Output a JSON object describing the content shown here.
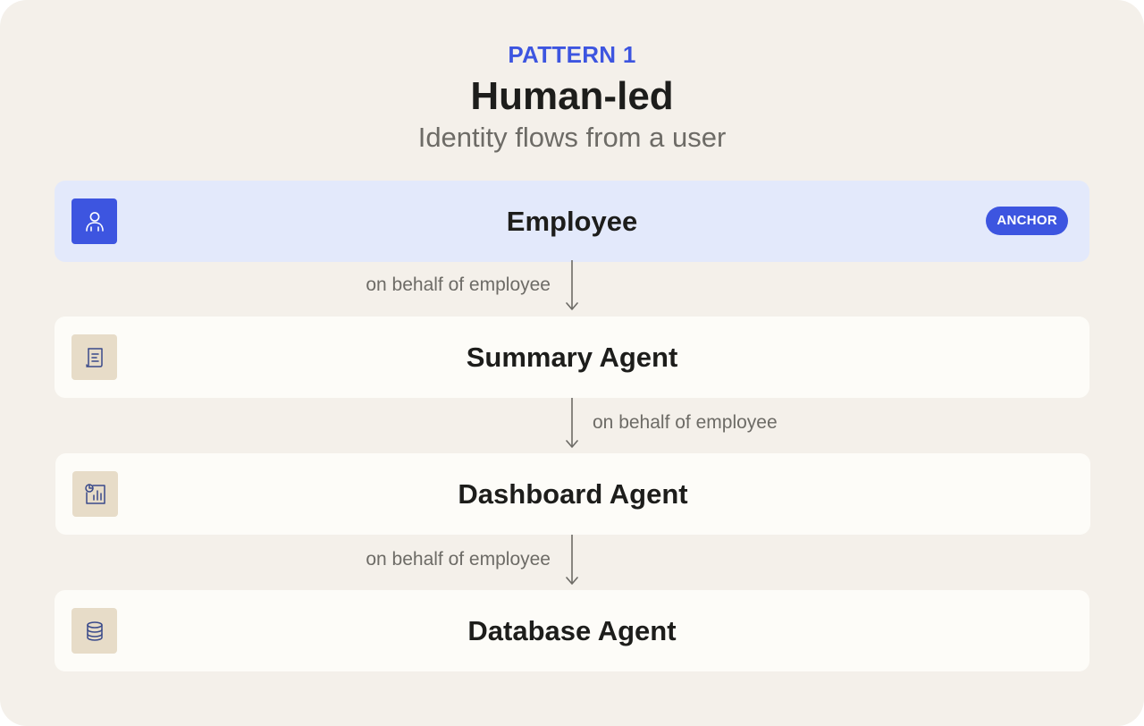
{
  "header": {
    "eyebrow": "PATTERN 1",
    "title": "Human-led",
    "subtitle": "Identity flows from a user"
  },
  "colors": {
    "accent": "#3d55e0",
    "background": "#f4f0ea",
    "card": "#fdfcf8",
    "anchor_card": "#e3e9fb",
    "icon_tile": "#e7dcc8"
  },
  "nodes": [
    {
      "label": "Employee",
      "icon": "person-icon",
      "badge": "ANCHOR"
    },
    {
      "label": "Summary Agent",
      "icon": "document-icon"
    },
    {
      "label": "Dashboard Agent",
      "icon": "dashboard-chart-icon"
    },
    {
      "label": "Database Agent",
      "icon": "database-icon"
    }
  ],
  "edges": [
    {
      "label": "on behalf of employee",
      "side": "left"
    },
    {
      "label": "on behalf of employee",
      "side": "right"
    },
    {
      "label": "on behalf of employee",
      "side": "left"
    }
  ]
}
